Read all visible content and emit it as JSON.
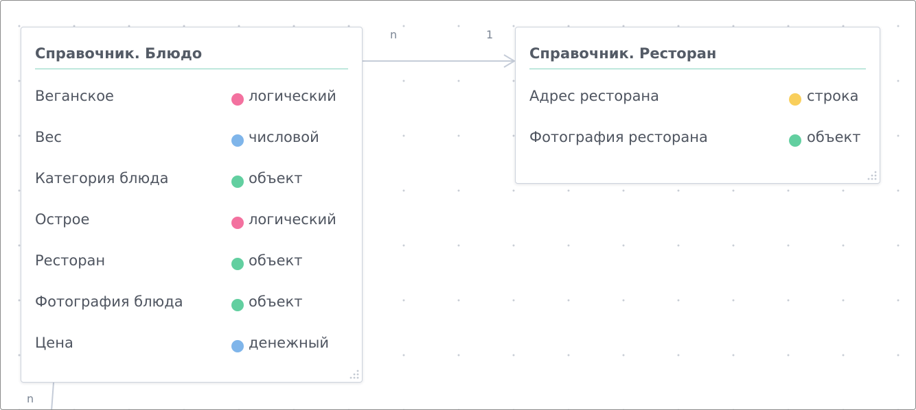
{
  "colors": {
    "logical": "#f3719f",
    "numeric": "#7fb5ea",
    "object": "#62cfa0",
    "string": "#f9cf5c",
    "money": "#7fb5ea",
    "accent_line": "#86d3bd",
    "connector": "#c5ccd8"
  },
  "relations": [
    {
      "from_label": "n",
      "to_label": "1"
    },
    {
      "from_label": "n"
    }
  ],
  "entities": [
    {
      "title": "Справочник. Блюдо",
      "fields": [
        {
          "name": "Веганское",
          "type": "логический",
          "color": "#f3719f"
        },
        {
          "name": "Вес",
          "type": "числовой",
          "color": "#7fb5ea"
        },
        {
          "name": "Категория блюда",
          "type": "объект",
          "color": "#62cfa0"
        },
        {
          "name": "Острое",
          "type": "логический",
          "color": "#f3719f"
        },
        {
          "name": "Ресторан",
          "type": "объект",
          "color": "#62cfa0"
        },
        {
          "name": "Фотография блюда",
          "type": "объект",
          "color": "#62cfa0"
        },
        {
          "name": "Цена",
          "type": "денежный",
          "color": "#7fb5ea"
        }
      ]
    },
    {
      "title": "Справочник. Ресторан",
      "fields": [
        {
          "name": "Адрес ресторана",
          "type": "строка",
          "color": "#f9cf5c"
        },
        {
          "name": "Фотография ресторана",
          "type": "объект",
          "color": "#62cfa0"
        }
      ]
    }
  ]
}
